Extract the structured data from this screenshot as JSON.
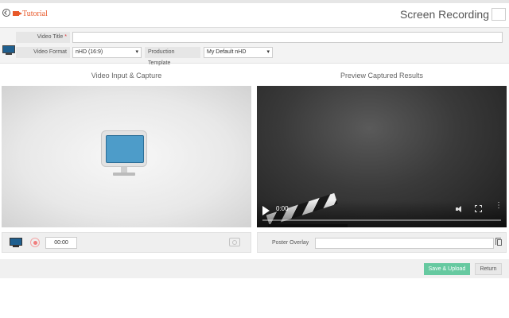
{
  "header": {
    "back_icon": "back-arrow-circle-icon",
    "camera_icon": "video-camera-icon",
    "tutorial_label": "Tutorial",
    "page_title": "Screen Recording",
    "accent_color": "#e8592a"
  },
  "form": {
    "video_title": {
      "label": "Video Title",
      "required_mark": "*",
      "value": ""
    },
    "video_format": {
      "label": "Video Format",
      "value": "nHD (16:9)"
    },
    "production_template": {
      "label": "Production Template",
      "value": "My Default nHD"
    }
  },
  "left_panel": {
    "title": "Video Input & Capture",
    "timer": "00:00"
  },
  "right_panel": {
    "title": "Preview Captured Results",
    "player_time": "0:00",
    "poster_overlay_label": "Poster Overlay",
    "poster_overlay_value": ""
  },
  "footer": {
    "save_label": "Save & Upload",
    "save_color": "#66c9a0",
    "return_label": "Return"
  }
}
